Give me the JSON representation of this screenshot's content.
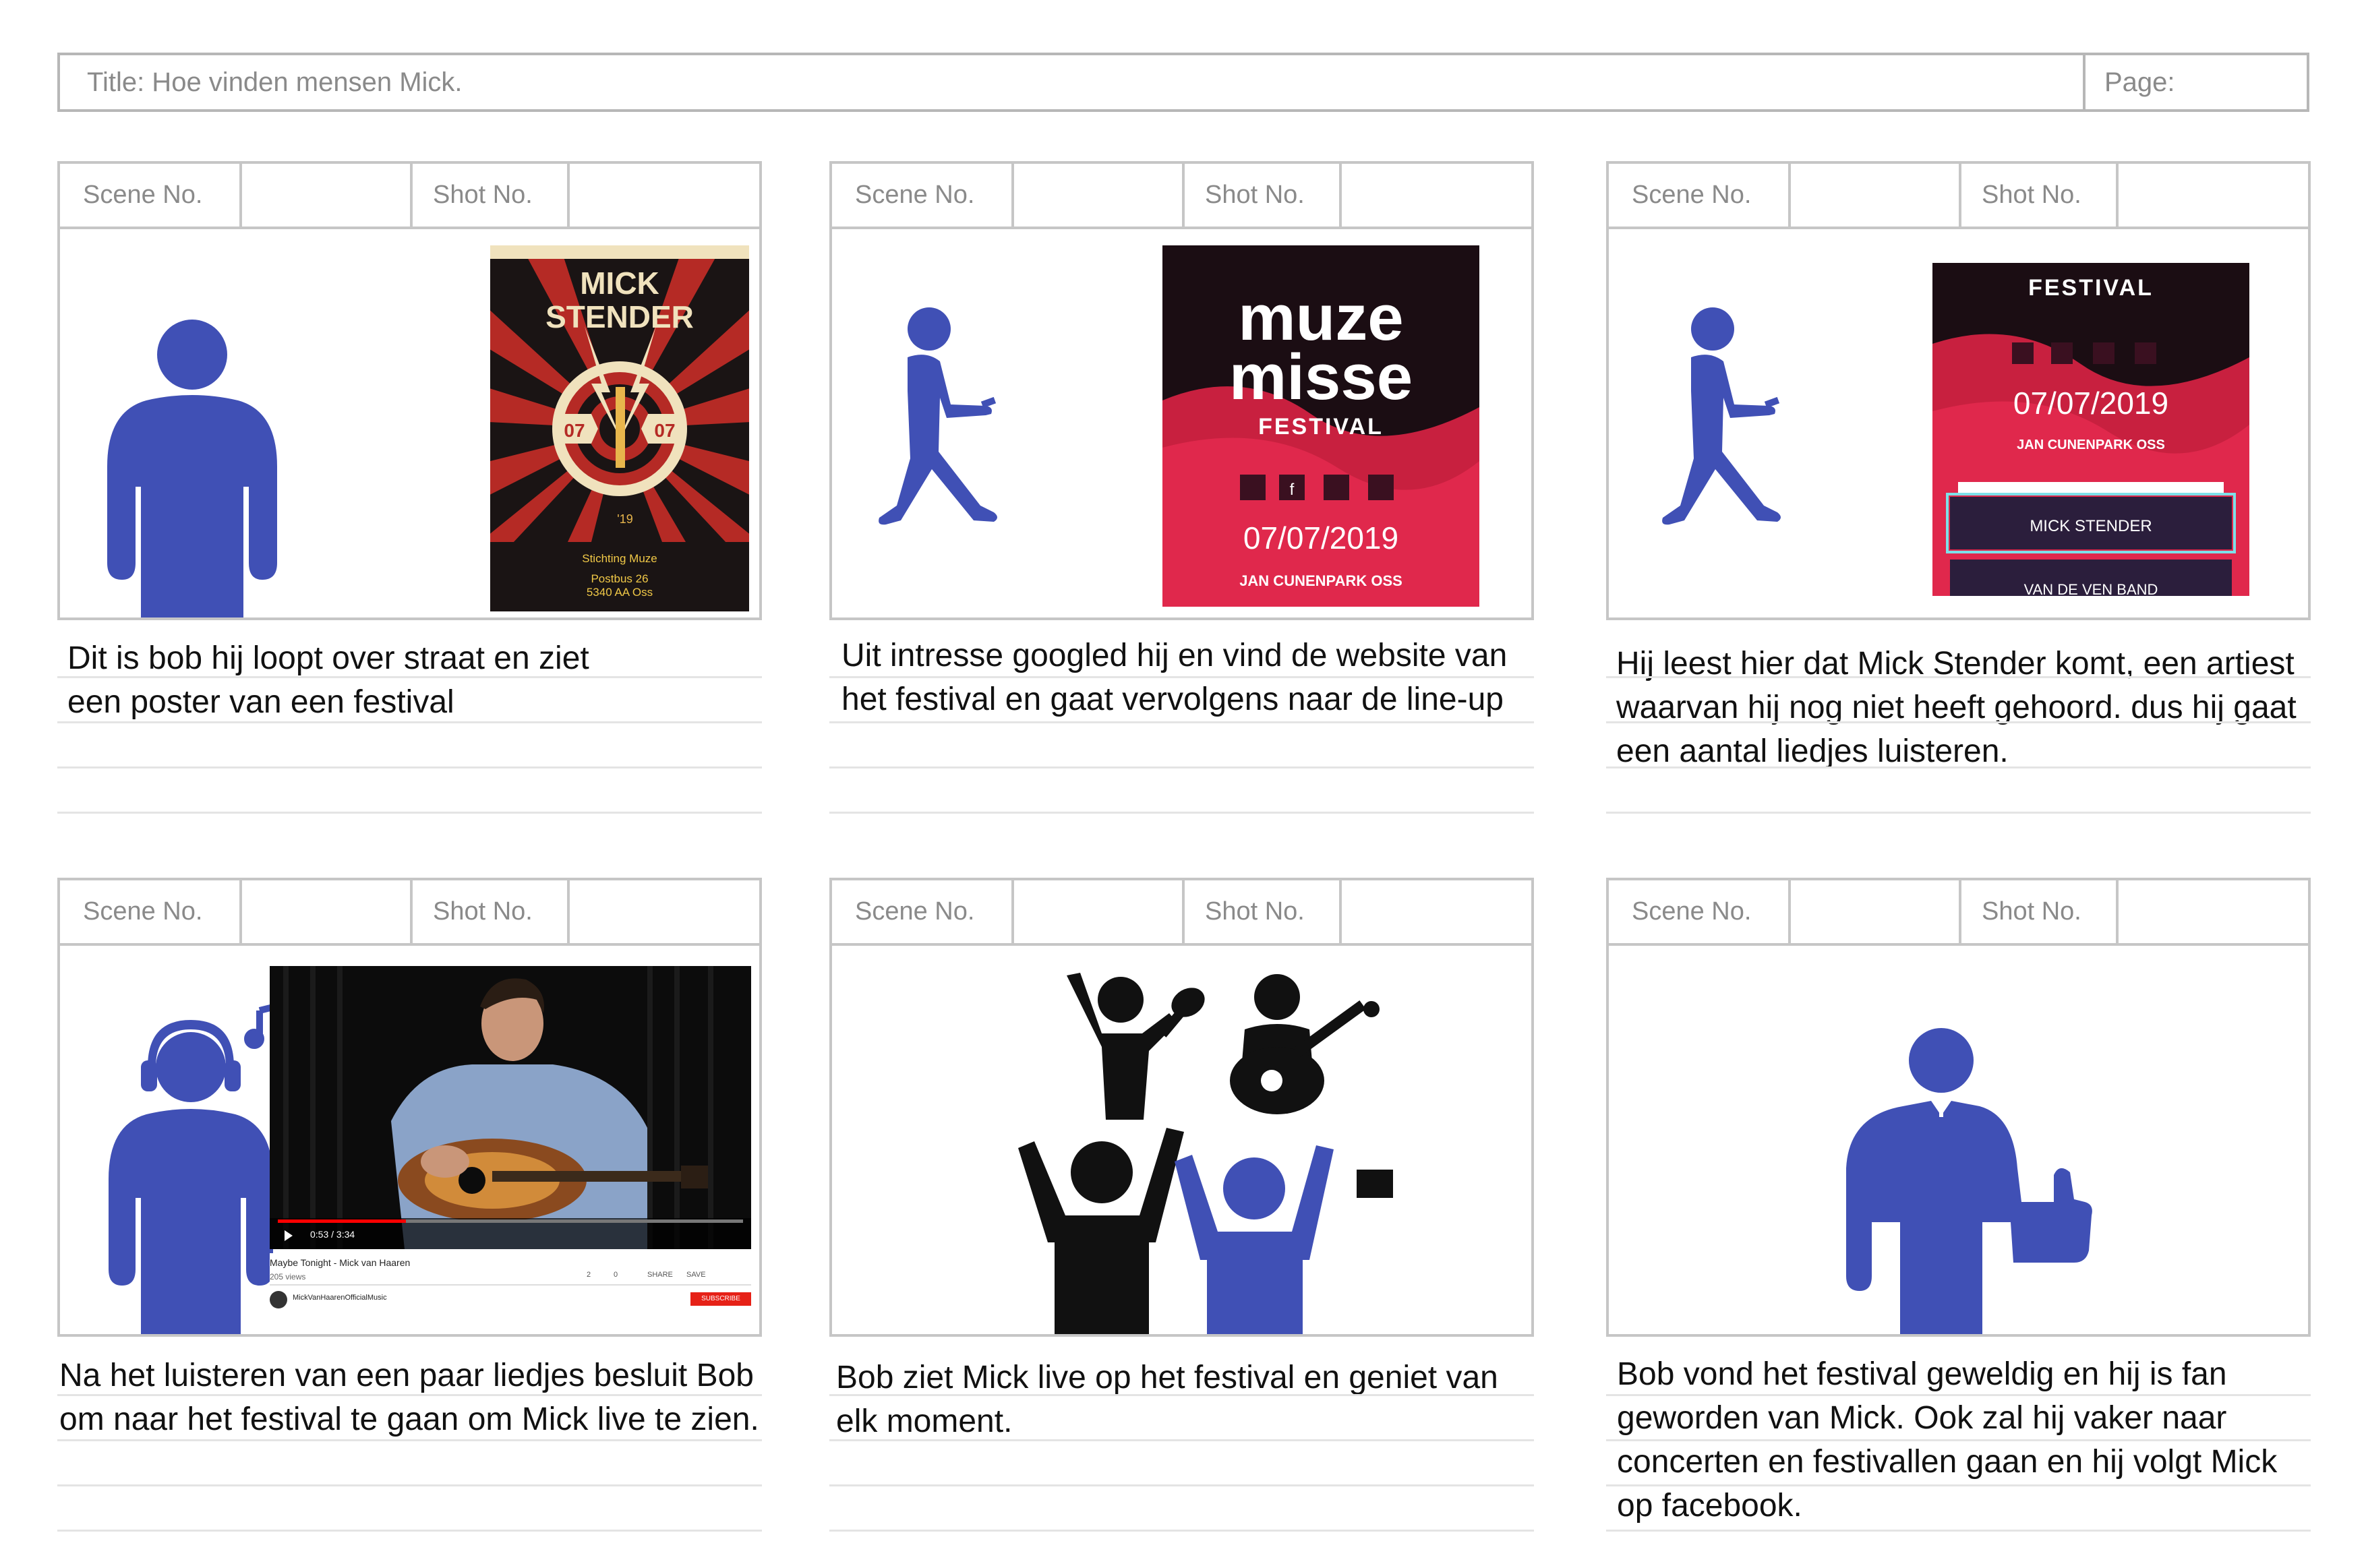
{
  "header": {
    "title": "Title: Hoe vinden mensen Mick.",
    "page_label": "Page:"
  },
  "labels": {
    "scene": "Scene No.",
    "shot": "Shot No."
  },
  "colors": {
    "figure": "#4050b5",
    "border": "#c6c6c6",
    "poster_red": "#c8203f",
    "poster_dark": "#2b1e3c"
  },
  "panels": [
    {
      "caption": "Dit is bob hij loopt over straat en ziet een poster van een festival",
      "poster": {
        "line1": "MICK",
        "line2": "STENDER",
        "left_num": "07",
        "right_num": "07",
        "year": "'19",
        "org": "Stichting Muze",
        "address1": "Postbus 26",
        "address2": "5340 AA  Oss"
      }
    },
    {
      "caption": "Uit intresse googled hij en vind de website van het festival en gaat vervolgens naar de line-up",
      "poster": {
        "line1": "muze",
        "line2": "misse",
        "line3": "FESTIVAL",
        "date": "07/07/2019",
        "venue": "JAN CUNENPARK OSS"
      }
    },
    {
      "caption": "Hij leest hier dat Mick Stender komt, een artiest waarvan hij nog niet heeft gehoord. dus hij gaat een aantal liedjes luisteren.",
      "poster": {
        "line3": "FESTIVAL",
        "date": "07/07/2019",
        "venue": "JAN CUNENPARK OSS",
        "act1": "MICK STENDER",
        "act2": "VAN DE VEN BAND"
      }
    },
    {
      "caption": "Na het luisteren van een paar liedjes besluit Bob om naar het festival te gaan om Mick live te zien.",
      "video": {
        "title": "Maybe Tonight - Mick van Haaren",
        "views": "205 views",
        "time": "0:53 / 3:34",
        "channel": "MickVanHaarenOfficialMusic",
        "likes": "2",
        "dislikes": "0",
        "share": "SHARE",
        "save": "SAVE",
        "subscribe": "SUBSCRIBE"
      }
    },
    {
      "caption": "Bob ziet Mick live op het festival en geniet van elk moment."
    },
    {
      "caption": "Bob vond het festival geweldig en hij is fan geworden van Mick. Ook zal hij vaker naar concerten en festivallen gaan en hij volgt Mick op facebook."
    }
  ]
}
